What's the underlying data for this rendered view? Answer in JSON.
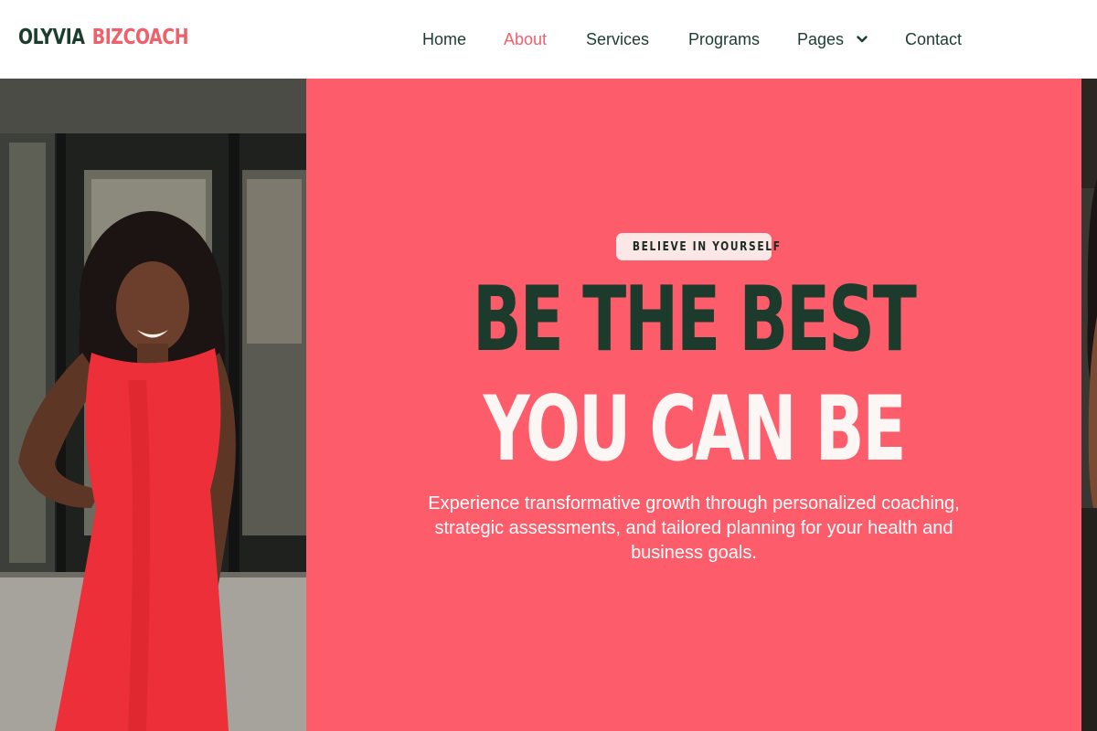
{
  "brand": {
    "part1": "OLYVIA",
    "part2": "BIZCOACH"
  },
  "nav": {
    "items": [
      {
        "label": "Home",
        "active": false
      },
      {
        "label": "About",
        "active": true
      },
      {
        "label": "Services",
        "active": false
      },
      {
        "label": "Programs",
        "active": false
      },
      {
        "label": "Pages",
        "active": false,
        "icon": "chevron-down-icon"
      },
      {
        "label": "Contact",
        "active": false
      }
    ]
  },
  "hero": {
    "badge": "BELIEVE IN YOURSELF",
    "headline_line1": "BE THE BEST",
    "headline_line2": "YOU CAN BE",
    "description": "Experience transformative growth through personalized coaching, strategic assessments, and tailored planning for your health and business goals."
  },
  "colors": {
    "accent": "#fd5d6b",
    "dark_green": "#1c3b2c",
    "badge_bg": "#fbe8e6",
    "nav_active": "#f0606b"
  }
}
